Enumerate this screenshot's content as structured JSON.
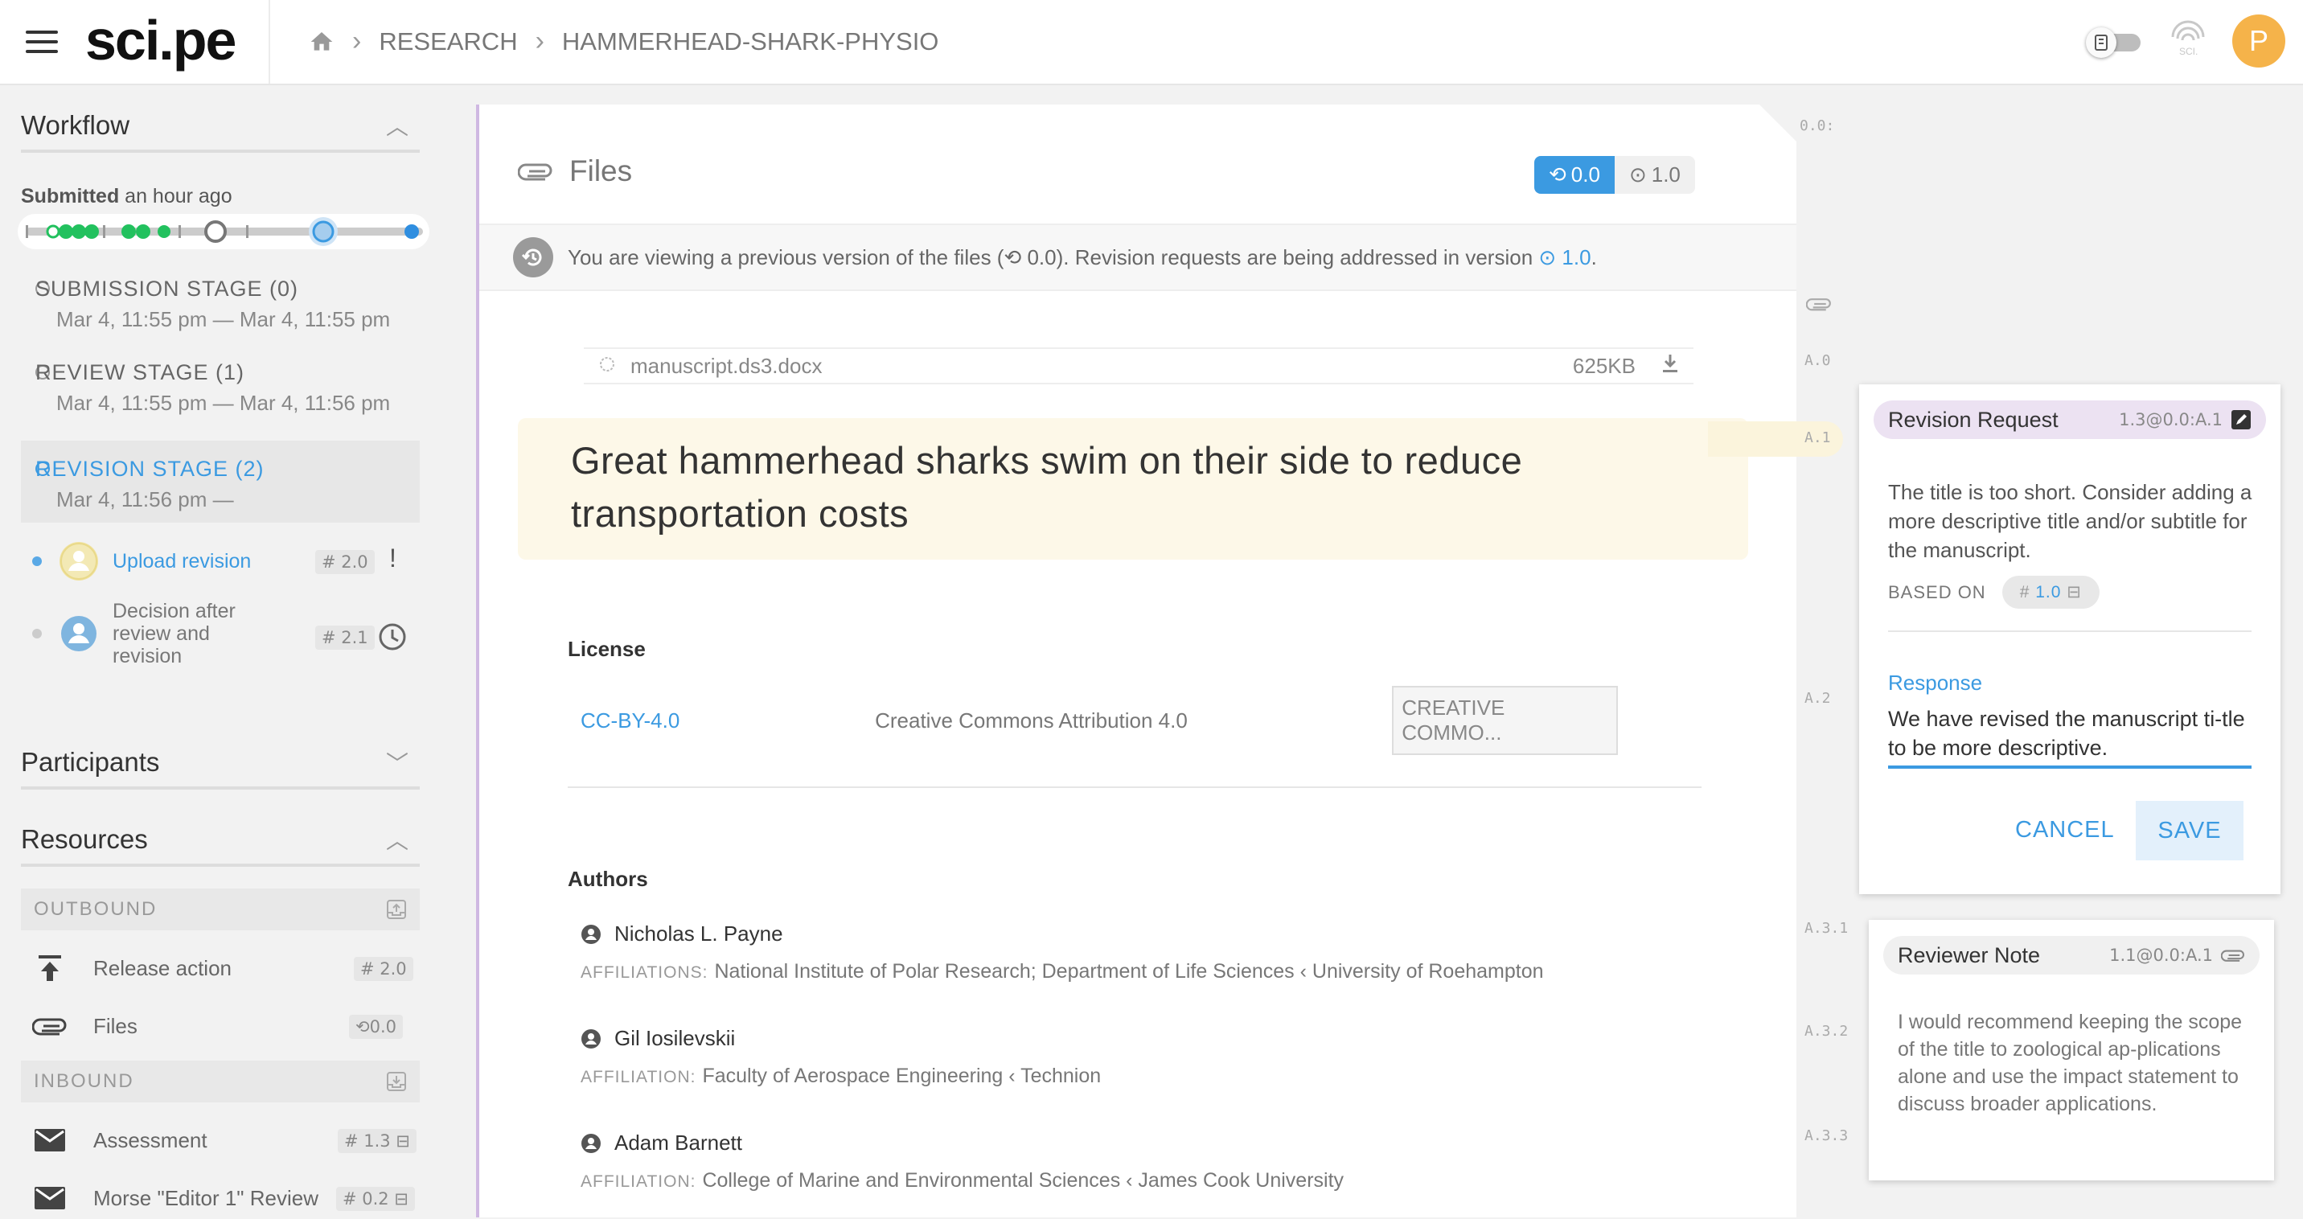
{
  "app": {
    "logo": "sci.pe",
    "avatar_initial": "P"
  },
  "breadcrumb": {
    "items": [
      "RESEARCH",
      "HAMMERHEAD-SHARK-PHYSIO"
    ]
  },
  "sidebar": {
    "workflow_title": "Workflow",
    "submitted_label": "Submitted",
    "submitted_time": "an hour ago",
    "stages": [
      {
        "name": "SUBMISSION STAGE (0)",
        "dates": "Mar 4, 11:55 pm  —  Mar 4, 11:55 pm"
      },
      {
        "name": "REVIEW STAGE (1)",
        "dates": "Mar 4, 11:55 pm  —  Mar 4, 11:56 pm"
      },
      {
        "name": "REVISION STAGE (2)",
        "dates": "Mar 4, 11:56 pm  —"
      }
    ],
    "tasks": [
      {
        "label": "Upload revision",
        "version": "# 2.0",
        "status": "!"
      },
      {
        "label": "Decision after review and revision",
        "version": "# 2.1"
      }
    ],
    "participants_title": "Participants",
    "resources_title": "Resources",
    "outbound_label": "OUTBOUND",
    "inbound_label": "INBOUND",
    "outbound_items": [
      {
        "label": "Release action",
        "version": "# 2.0"
      },
      {
        "label": "Files",
        "version": "0.0"
      }
    ],
    "inbound_items": [
      {
        "label": "Assessment",
        "version": "# 1.3 ⊟"
      },
      {
        "label": "Morse \"Editor 1\" Review",
        "version": "# 0.2 ⊟"
      }
    ]
  },
  "main": {
    "title": "Files",
    "version_active": "0.0",
    "version_other": "1.0",
    "banner": {
      "text_before": "You are viewing a previous version of the files (",
      "prev_version": "0.0",
      "text_middle": "). Revision requests are being addressed in version ",
      "new_version": "1.0",
      "text_after": "."
    },
    "file": {
      "name": "manuscript.ds3.docx",
      "size": "625KB"
    },
    "manuscript_title": "Great hammerhead sharks swim on their side to reduce transportation costs",
    "license_label": "License",
    "license": {
      "code": "CC-BY-4.0",
      "name": "Creative Commons Attribution 4.0",
      "button": "CREATIVE COMMO..."
    },
    "authors_label": "Authors",
    "authors": [
      {
        "name": "Nicholas L. Payne",
        "affil_label": "AFFILIATIONS:",
        "affil": "National Institute of Polar Research; Department of Life Sciences ‹ University of Roehampton"
      },
      {
        "name": "Gil Iosilevskii",
        "affil_label": "AFFILIATION:",
        "affil": "Faculty of Aerospace Engineering ‹ Technion"
      },
      {
        "name": "Adam Barnett",
        "affil_label": "AFFILIATION:",
        "affil": "College of Marine and Environmental Sciences ‹ James Cook University"
      }
    ]
  },
  "anchors": [
    "0.0:",
    "A.0",
    "A.1",
    "A.2",
    "A.3.1",
    "A.3.2",
    "A.3.3"
  ],
  "revision_card": {
    "title": "Revision Request",
    "ref": "1.3@0.0:A.1",
    "body": "The title is too short. Consider adding a more descriptive title and/or subtitle for the manuscript.",
    "based_on_label": "BASED ON",
    "based_on_version": "1.0",
    "response_label": "Response",
    "response_text": "We have revised the manuscript ti-tle to be more descriptive.",
    "cancel_label": "CANCEL",
    "save_label": "SAVE"
  },
  "reviewer_card": {
    "title": "Reviewer Note",
    "ref": "1.1@0.0:A.1",
    "body": "I would recommend keeping the scope of the title to zoological ap-plications alone and use the impact statement to discuss broader applications."
  },
  "colors": {
    "accent": "#3b9ae1",
    "avatar": "#f5b34a",
    "highlight": "#fdf8e8",
    "green": "#22c15e",
    "purple_head": "#ece2f2"
  }
}
